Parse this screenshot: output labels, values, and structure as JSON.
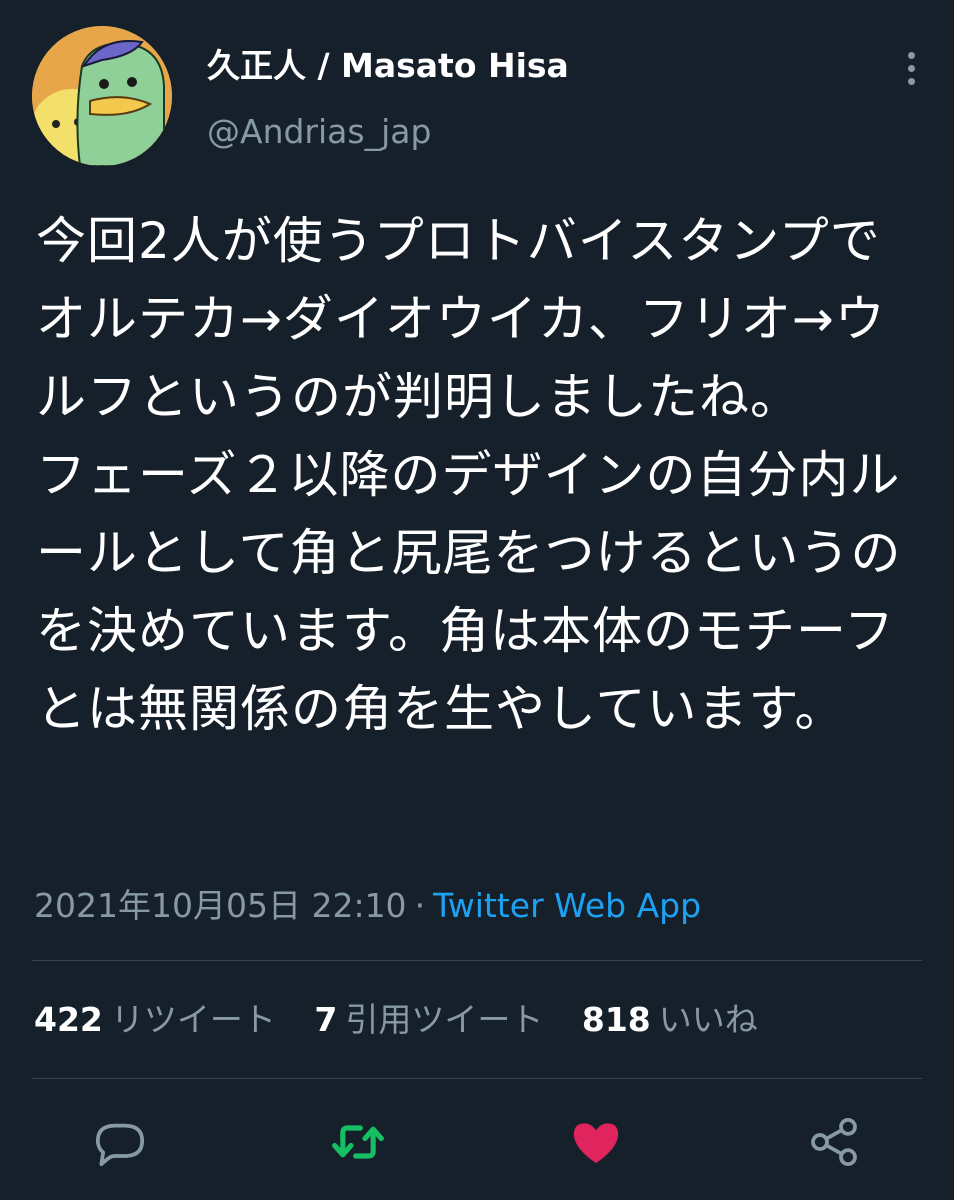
{
  "author": {
    "display_name": "久正人 / Masato Hisa",
    "handle": "@Andrias_jap"
  },
  "tweet": {
    "text": "今回2人が使うプロトバイスタンプでオルテカ→ダイオウイカ、フリオ→ウルフというのが判明しましたね。\nフェーズ２以降のデザインの自分内ルールとして角と尻尾をつけるというのを決めています。角は本体のモチーフとは無関係の角を生やしています。",
    "timestamp": "2021年10月05日 22:10",
    "separator": "·",
    "source": "Twitter Web App"
  },
  "stats": {
    "retweets": {
      "count": "422",
      "label": "リツイート"
    },
    "quotes": {
      "count": "7",
      "label": "引用ツイート"
    },
    "likes": {
      "count": "818",
      "label": "いいね"
    }
  },
  "colors": {
    "background": "#15202b",
    "secondary_text": "#8899a6",
    "link": "#1da1f2",
    "retweet_active": "#17bf63",
    "like_active": "#e0245e",
    "divider": "#38444d"
  },
  "icons": {
    "more": "more-vertical-icon",
    "reply": "reply-icon",
    "retweet": "retweet-icon",
    "like": "heart-icon",
    "share": "share-icon"
  }
}
